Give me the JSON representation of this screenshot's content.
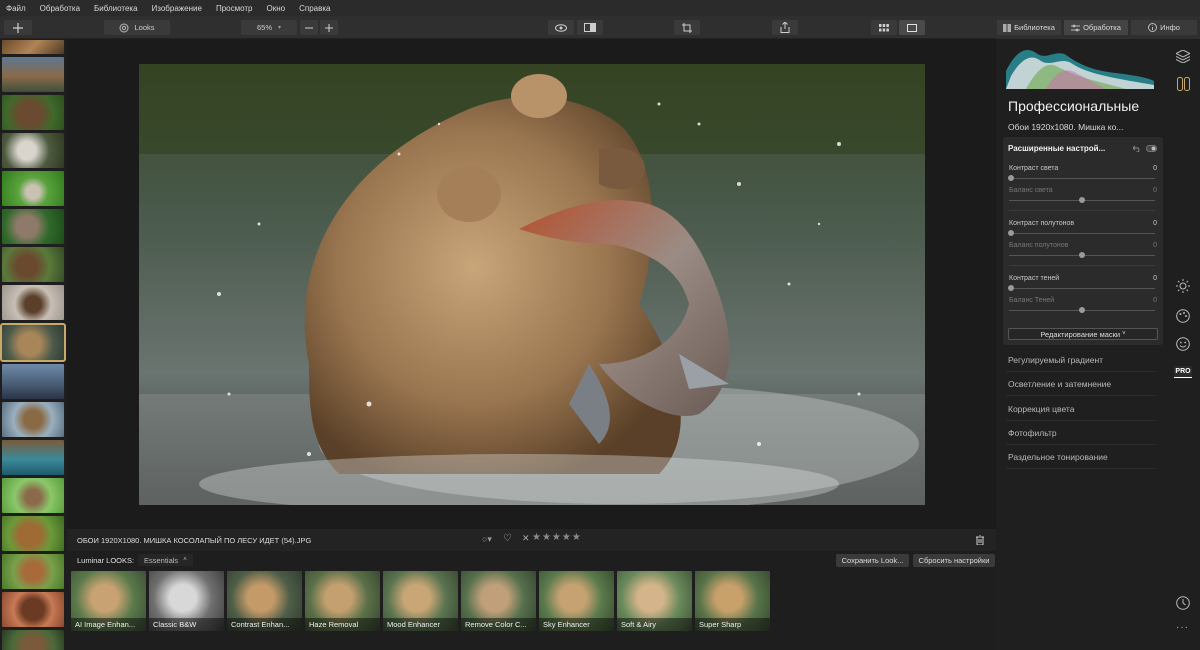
{
  "menu": [
    "Файл",
    "Обработка",
    "Библиотека",
    "Изображение",
    "Просмотр",
    "Окно",
    "Справка"
  ],
  "toolbar": {
    "looks_label": "Looks",
    "zoom_value": "65%"
  },
  "right_tabs": {
    "library": "Библиотека",
    "edit": "Обработка",
    "info": "Инфо"
  },
  "panel": {
    "workspace_title": "Профессиональные",
    "image_name_short": "Обои 1920x1080. Мишка ко...",
    "filter_title": "Расширенные настрой...",
    "sliders": [
      {
        "label": "Контраст света",
        "value": "0",
        "dim": false
      },
      {
        "label": "Баланс света",
        "value": "0",
        "dim": true
      },
      {
        "label": "Контраст полутонов",
        "value": "0",
        "dim": false
      },
      {
        "label": "Баланс полутонов",
        "value": "0",
        "dim": true
      },
      {
        "label": "Контраст теней",
        "value": "0",
        "dim": false
      },
      {
        "label": "Баланс Теней",
        "value": "0",
        "dim": true
      }
    ],
    "mask_button": "Редактирование маски",
    "tools": [
      "Регулируемый градиент",
      "Осветление и затемнение",
      "Коррекция цвета",
      "Фотофильтр",
      "Раздельное тонирование"
    ]
  },
  "infobar": {
    "filename": "ОБОИ 1920X1080. МИШКА КОСОЛАПЫЙ ПО ЛЕСУ ИДЕТ (54).JPG"
  },
  "looks": {
    "label": "Luminar LOOKS:",
    "category": "Essentials",
    "save_button": "Сохранить Look...",
    "reset_button": "Сбросить настройки",
    "items": [
      "AI Image Enhan...",
      "Classic B&W",
      "Contrast Enhan...",
      "Haze Removal",
      "Mood Enhancer",
      "Remove Color C...",
      "Sky Enhancer",
      "Soft & Airy",
      "Super Sharp"
    ]
  },
  "colors": {
    "accent_selected": "#c8a96a",
    "pro_badge": "#ffffff"
  }
}
